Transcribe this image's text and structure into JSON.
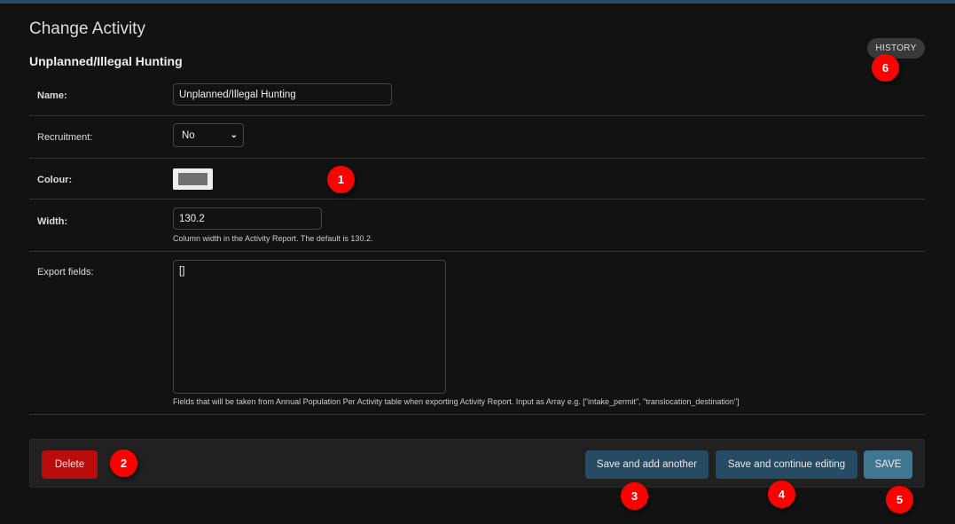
{
  "page": {
    "title": "Change Activity",
    "object_title": "Unplanned/Illegal Hunting",
    "history_label": "HISTORY"
  },
  "form": {
    "name": {
      "label": "Name:",
      "value": "Unplanned/Illegal Hunting"
    },
    "recruitment": {
      "label": "Recruitment:",
      "value": "No"
    },
    "colour": {
      "label": "Colour:",
      "value": "#707070"
    },
    "width": {
      "label": "Width:",
      "value": "130.2",
      "help": "Column width in the Activity Report. The default is 130.2."
    },
    "export_fields": {
      "label": "Export fields:",
      "value": "[]",
      "help": "Fields that will be taken from Annual Population Per Activity table when exporting Activity Report. Input as Array e.g. [\"intake_permit\", \"translocation_destination\"]"
    }
  },
  "actions": {
    "delete": "Delete",
    "save_add": "Save and add another",
    "save_continue": "Save and continue editing",
    "save": "SAVE"
  },
  "badges": [
    "1",
    "2",
    "3",
    "4",
    "5",
    "6"
  ],
  "colors": {
    "accent": "#2b4a63",
    "delete": "#ba0c0c",
    "save": "#417690",
    "secondary": "#264b63",
    "badge": "#ff0000"
  }
}
